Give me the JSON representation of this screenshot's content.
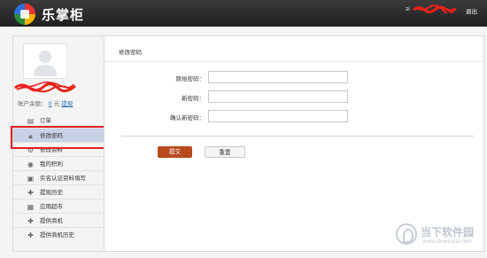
{
  "header": {
    "brand": "乐掌柜",
    "user_prefix": "zi",
    "logout_label": "退出"
  },
  "sidebar": {
    "balance_label": "账户余额：",
    "balance_amount": "0",
    "balance_unit": "元",
    "withdraw_label": "提现",
    "items": [
      {
        "label": "订单",
        "icon": "clipboard-icon"
      },
      {
        "label": "修改密码",
        "icon": "lock-icon",
        "active": true
      },
      {
        "label": "修改资料",
        "icon": "gear-icon"
      },
      {
        "label": "我的积利",
        "icon": "coins-icon"
      },
      {
        "label": "实名认证资料填写",
        "icon": "id-card-icon"
      },
      {
        "label": "提现历史",
        "icon": "history-icon"
      },
      {
        "label": "应用超市",
        "icon": "market-icon"
      },
      {
        "label": "提供商机",
        "icon": "opportunity-icon"
      },
      {
        "label": "提供商机历史",
        "icon": "opportunity-history-icon"
      }
    ]
  },
  "main": {
    "title": "修改密码",
    "fields": [
      {
        "label": "原始密码：",
        "value": ""
      },
      {
        "label": "新密码：",
        "value": ""
      },
      {
        "label": "确认新密码：",
        "value": ""
      }
    ],
    "submit_label": "提交",
    "reset_label": "重置"
  },
  "watermark": {
    "cn": "当下软件园",
    "en": "www.downxia.com"
  },
  "colors": {
    "header_bg": "#2b2b2b",
    "submit_bg": "#b84a1e",
    "active_menu_bg": "#c9d1e6",
    "highlight": "#e02020",
    "link": "#2a6ebb"
  }
}
